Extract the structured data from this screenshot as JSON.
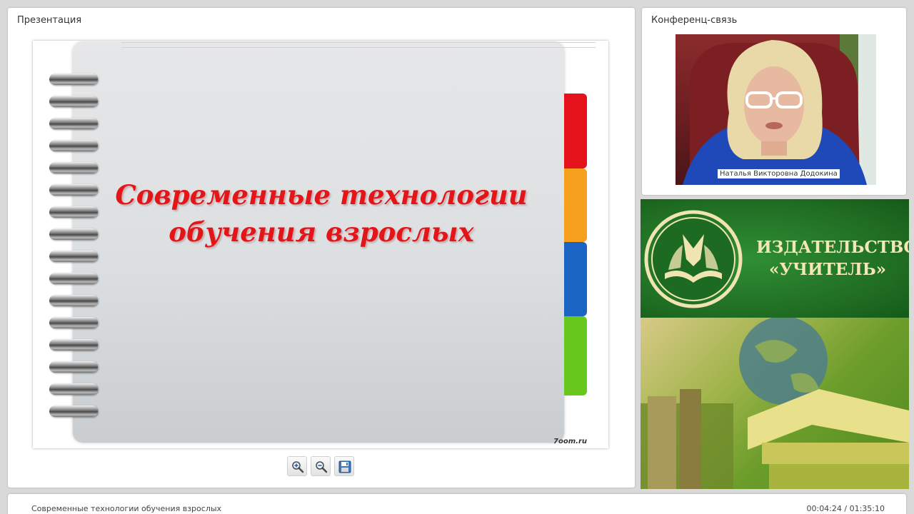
{
  "presentation": {
    "title": "Презентация",
    "slide": {
      "title_lines": [
        "Современные технологии",
        "обучения взрослых"
      ],
      "watermark": "7oom.ru",
      "tab_colors": [
        "#e5121b",
        "#f7a01e",
        "#1a65c4",
        "#69c81e"
      ],
      "title_color": "#e41519"
    },
    "toolbar": {
      "zoom_in_icon": "zoom-in-icon",
      "zoom_out_icon": "zoom-out-icon",
      "save_icon": "save-icon"
    }
  },
  "conference": {
    "title": "Конференц-связь",
    "participant_name": "Наталья Викторовна Додокина"
  },
  "banner": {
    "publisher_lines": [
      "ИЗДАТЕЛЬСТВО",
      "«УЧИТЕЛЬ»"
    ],
    "logo_icon": "publisher-logo-icon"
  },
  "bottom_bar": {
    "title": "Современные технологии обучения взрослых",
    "time": "00:04:24 / 01:35:10"
  }
}
